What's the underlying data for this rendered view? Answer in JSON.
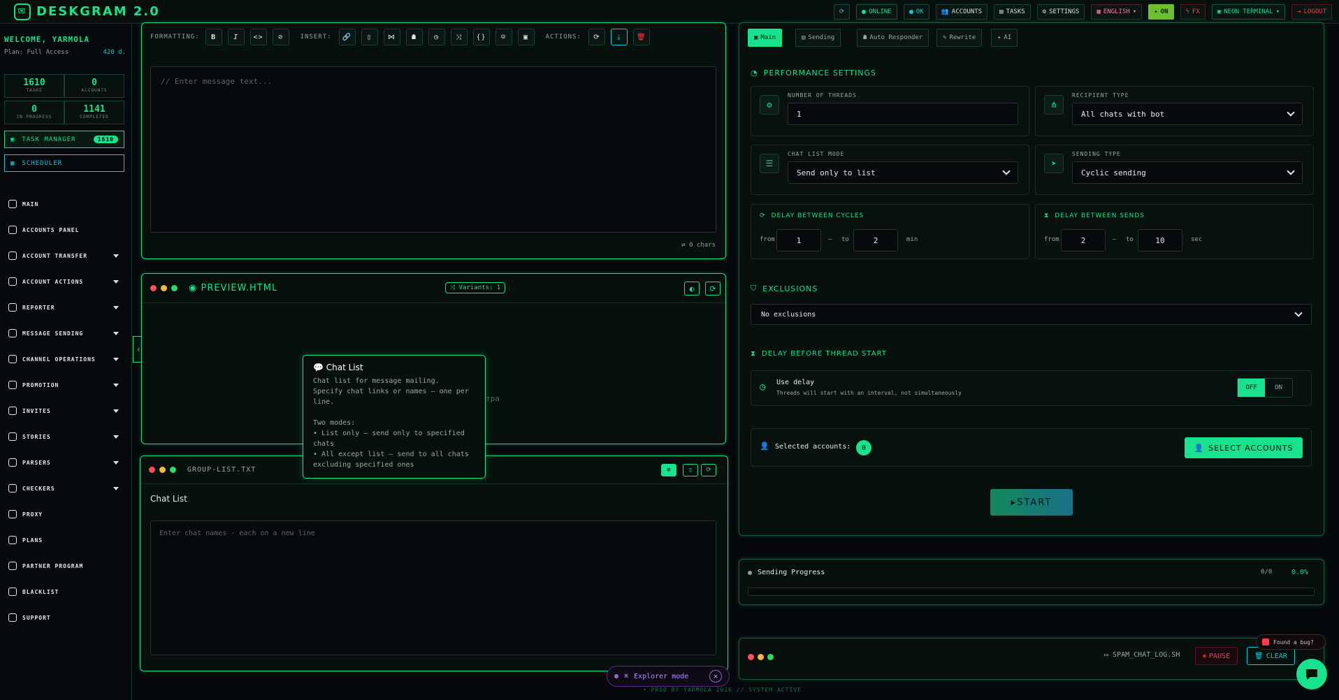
{
  "app": {
    "title": "DESKGRAM 2.0"
  },
  "topnav": {
    "refresh_icon": "refresh-icon",
    "online": "ONLINE",
    "ok": "OK",
    "accounts": "ACCOUNTS",
    "tasks": "TASKS",
    "settings": "SETTINGS",
    "language": "ENGLISH",
    "on": "ON",
    "fx": "FX",
    "theme": "NEON TERMINAL",
    "logout": "LOGOUT"
  },
  "sidebar": {
    "welcome": "WELCOME, YARMOLA",
    "plan": "Plan: Full Access",
    "days": "420 d.",
    "stats": [
      {
        "value": "1610",
        "label": "TASKS"
      },
      {
        "value": "0",
        "label": "ACCOUNTS"
      },
      {
        "value": "0",
        "label": "IN PROGRESS"
      },
      {
        "value": "1141",
        "label": "COMPLETED"
      }
    ],
    "task_manager": "TASK MANAGER",
    "task_badge": "1610",
    "scheduler": "SCHEDULER",
    "items": [
      {
        "label": "MAIN",
        "icon": "home-icon"
      },
      {
        "label": "ACCOUNTS PANEL",
        "icon": "users-icon"
      },
      {
        "label": "ACCOUNT TRANSFER",
        "icon": "user-transfer-icon"
      },
      {
        "label": "ACCOUNT ACTIONS",
        "icon": "user-gear-icon"
      },
      {
        "label": "REPORTER",
        "icon": "flag-icon"
      },
      {
        "label": "MESSAGE SENDING",
        "icon": "chat-icon"
      },
      {
        "label": "CHANNEL OPERATIONS",
        "icon": "channel-icon"
      },
      {
        "label": "PROMOTION",
        "icon": "chart-icon"
      },
      {
        "label": "INVITES",
        "icon": "invite-icon"
      },
      {
        "label": "STORIES",
        "icon": "stories-icon"
      },
      {
        "label": "PARSERS",
        "icon": "search-icon"
      },
      {
        "label": "CHECKERS",
        "icon": "check-icon"
      },
      {
        "label": "PROXY",
        "icon": "shield-icon"
      },
      {
        "label": "PLANS",
        "icon": "card-icon"
      },
      {
        "label": "PARTNER PROGRAM",
        "icon": "partner-icon"
      },
      {
        "label": "BLACKLIST",
        "icon": "block-icon"
      },
      {
        "label": "SUPPORT",
        "icon": "headset-icon"
      }
    ]
  },
  "editor": {
    "formatting_label": "FORMATTING:",
    "insert_label": "INSERT:",
    "actions_label": "ACTIONS:",
    "placeholder": "// Enter message text...",
    "chars": "0 chars",
    "format_buttons": [
      "B",
      "I",
      "<>",
      "⊘"
    ]
  },
  "preview": {
    "title": "PREVIEW.HTML",
    "variants": "Variants: 1",
    "fragment": "тра"
  },
  "tooltip": {
    "title": "Chat List",
    "body": "Chat list for message mailing.\nSpecify chat links or names — one per line.\n\nTwo modes:\n• List only — send only to specified chats\n• All except list — send to all chats excluding specified ones"
  },
  "group_list": {
    "file": "GROUP-LIST.TXT",
    "heading": "Chat List",
    "placeholder": "Enter chat names - each on a new line"
  },
  "settings": {
    "tabs": [
      "Main",
      "Sending",
      "Auto Responder",
      "Rewrite",
      "AI"
    ],
    "perf_title": "PERFORMANCE SETTINGS",
    "threads_label": "NUMBER OF THREADS",
    "threads_value": "1",
    "recipient_label": "RECIPIENT TYPE",
    "recipient_value": "All chats with bot",
    "chatmode_label": "CHAT LIST MODE",
    "chatmode_value": "Send only to list",
    "sendtype_label": "SENDING TYPE",
    "sendtype_value": "Cyclic sending",
    "cycles_title": "DELAY BETWEEN CYCLES",
    "cycles_from": "1",
    "cycles_to": "2",
    "cycles_unit": "min",
    "sends_title": "DELAY BETWEEN SENDS",
    "sends_from": "2",
    "sends_to": "10",
    "sends_unit": "sec",
    "from_label": "from",
    "to_label": "to",
    "excl_title": "EXCLUSIONS",
    "excl_value": "No exclusions",
    "delay_title": "DELAY BEFORE THREAD START",
    "use_delay": "Use delay",
    "use_delay_sub": "Threads will start with an interval, not simultaneously",
    "off": "OFF",
    "on": "ON",
    "selected_label": "Selected accounts:",
    "selected_count": "0",
    "select_btn": "SELECT ACCOUNTS",
    "start_btn": "START"
  },
  "progress": {
    "title": "Sending Progress",
    "count": "0/0",
    "percent": "0.0%",
    "fill": 0
  },
  "log": {
    "file": "SPAM_CHAT_LOG.SH",
    "pause": "PAUSE",
    "clear": "CLEAR"
  },
  "footer": "• PROD BY YARMOLA 2026   // SYSTEM ACTIVE",
  "explorer": "Explorer mode",
  "bug": "Found a bug?"
}
